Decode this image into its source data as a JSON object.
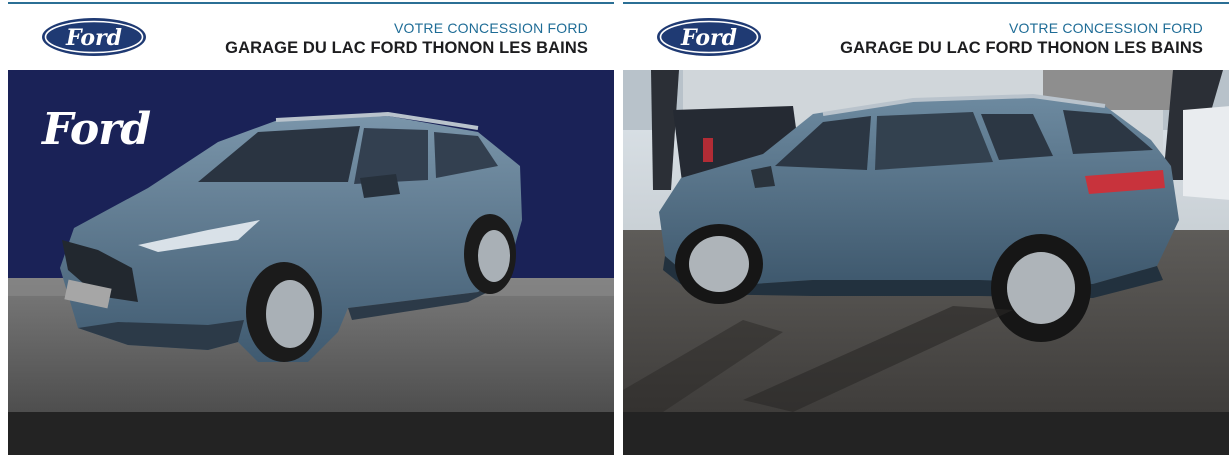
{
  "cards": [
    {
      "logo_text": "Ford",
      "dealer_subtitle": "VOTRE CONCESSION FORD",
      "dealer_name": "GARAGE DU LAC FORD THONON LES BAINS",
      "backdrop_logo": "Ford"
    },
    {
      "logo_text": "Ford",
      "dealer_subtitle": "VOTRE CONCESSION FORD",
      "dealer_name": "GARAGE DU LAC FORD THONON LES BAINS"
    }
  ],
  "colors": {
    "brand_blue": "#1f3a73",
    "accent_line": "#2b6f95",
    "backdrop_navy": "#1a2257",
    "car_body": "#54738c",
    "footer": "#232323"
  },
  "icons": [
    "ford-oval-logo"
  ]
}
